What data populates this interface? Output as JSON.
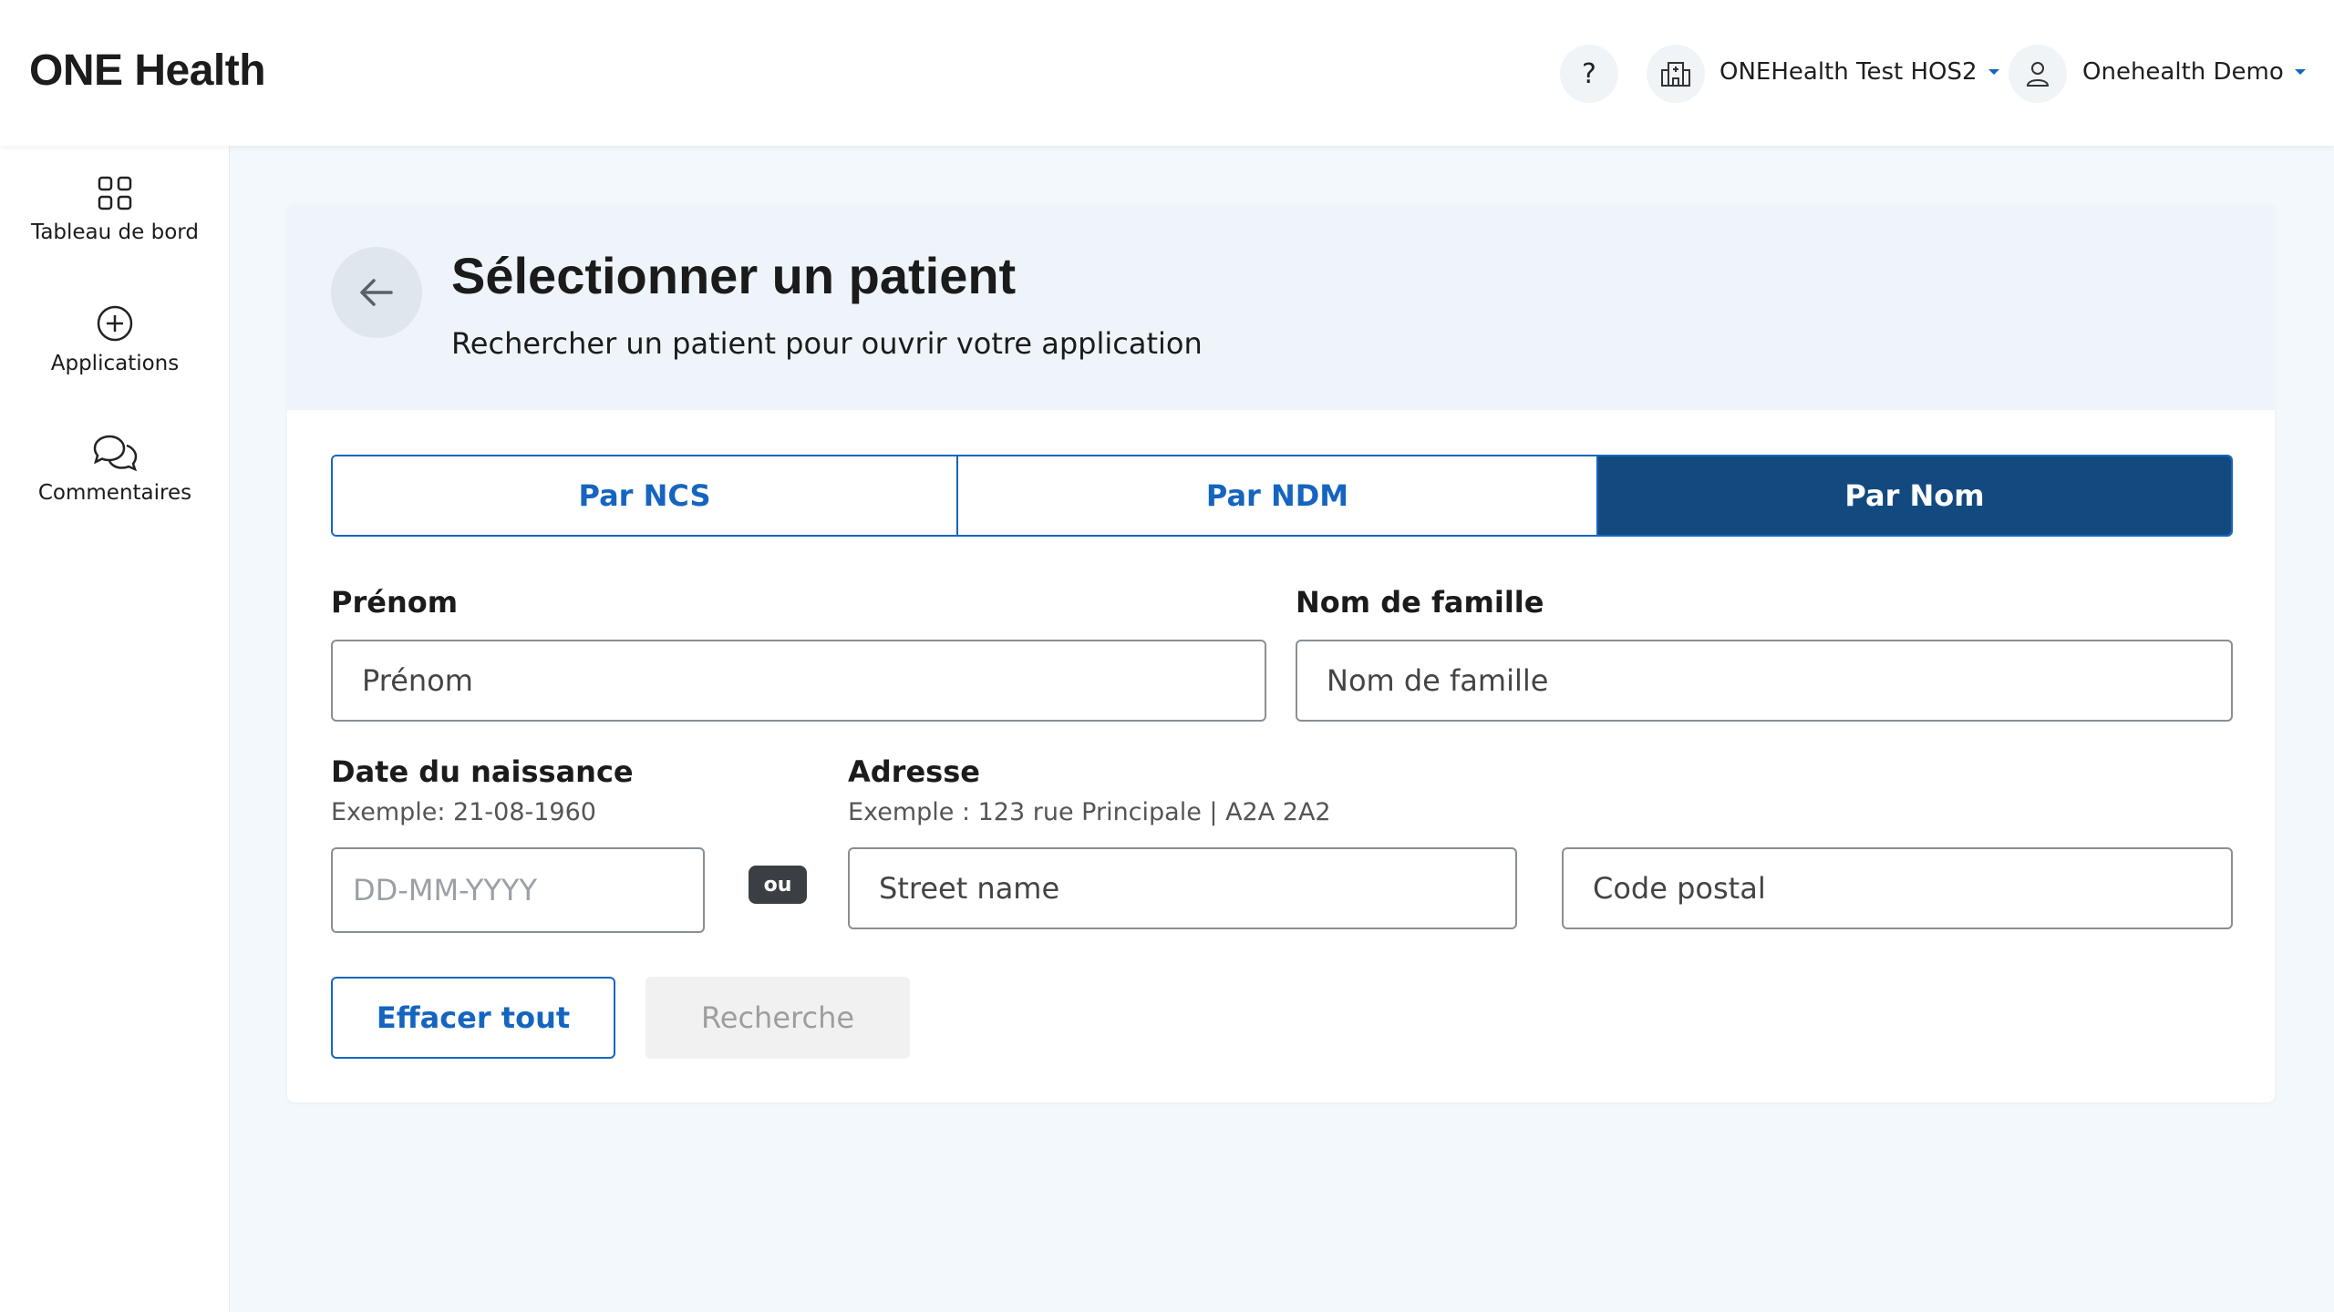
{
  "header": {
    "brand": "ONE Health",
    "help_label": "?",
    "hospital": "ONEHealth Test HOS2",
    "user": "Onehealth Demo"
  },
  "sidebar": {
    "items": [
      {
        "label": "Tableau de bord",
        "icon": "grid-icon"
      },
      {
        "label": "Applications",
        "icon": "plus-circle-icon"
      },
      {
        "label": "Commentaires",
        "icon": "chat-bubbles-icon"
      }
    ]
  },
  "card": {
    "title": "Sélectionner un patient",
    "subtitle": "Rechercher un patient pour ouvrir votre application"
  },
  "tabs": [
    {
      "label": "Par NCS",
      "active": false
    },
    {
      "label": "Par NDM",
      "active": false
    },
    {
      "label": "Par Nom",
      "active": true
    }
  ],
  "form": {
    "first_name": {
      "label": "Prénom",
      "placeholder": "Prénom"
    },
    "last_name": {
      "label": "Nom de famille",
      "placeholder": "Nom de famille"
    },
    "dob": {
      "label": "Date du naissance",
      "hint": "Exemple: 21-08-1960",
      "placeholder": "DD-MM-YYYY"
    },
    "or_label": "ou",
    "address": {
      "label": "Adresse",
      "hint": "Exemple : 123 rue Principale | A2A 2A2",
      "street_placeholder": "Street name",
      "postal_placeholder": "Code postal"
    }
  },
  "buttons": {
    "clear": "Effacer tout",
    "search": "Recherche"
  },
  "colors": {
    "accent": "#1565c0",
    "active_tab": "#124a80",
    "page_bg": "#f3f8fc"
  }
}
